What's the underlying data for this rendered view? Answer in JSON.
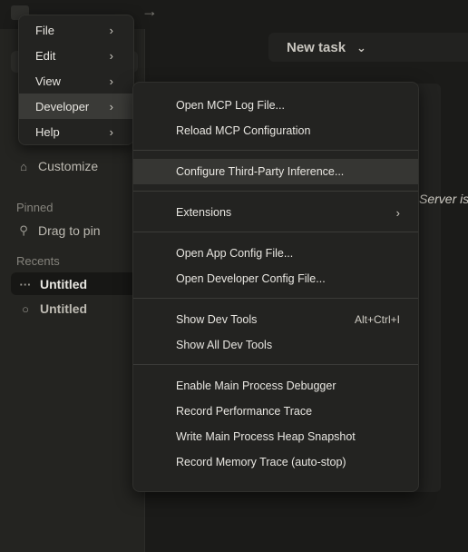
{
  "titlebar": {
    "menu_icon": "hamburger-icon",
    "forward_icon": "arrow-right-icon"
  },
  "sidebar": {
    "customize": "Customize",
    "pinned_label": "Pinned",
    "drag_to_pin": "Drag to pin",
    "recents_label": "Recents",
    "recents": [
      {
        "title": "Untitled",
        "marker": "···"
      },
      {
        "title": "Untitled",
        "marker": "○"
      }
    ]
  },
  "main": {
    "task_title": "New task",
    "status_text": "Server is"
  },
  "menu": {
    "items": [
      {
        "label": "File",
        "chevron": "›"
      },
      {
        "label": "Edit",
        "chevron": "›"
      },
      {
        "label": "View",
        "chevron": "›"
      },
      {
        "label": "Developer",
        "chevron": "›"
      },
      {
        "label": "Help",
        "chevron": "›"
      }
    ]
  },
  "developer_menu": {
    "open_mcp_log": "Open MCP Log File...",
    "reload_mcp": "Reload MCP Configuration",
    "configure_inference": "Configure Third-Party Inference...",
    "extensions": "Extensions",
    "extensions_chevron": "›",
    "open_app_config": "Open App Config File...",
    "open_dev_config": "Open Developer Config File...",
    "show_dev_tools": "Show Dev Tools",
    "show_dev_tools_shortcut": "Alt+Ctrl+I",
    "show_all_dev_tools": "Show All Dev Tools",
    "enable_debugger": "Enable Main Process Debugger",
    "record_perf": "Record Performance Trace",
    "write_heap": "Write Main Process Heap Snapshot",
    "record_memory": "Record Memory Trace (auto-stop)"
  }
}
